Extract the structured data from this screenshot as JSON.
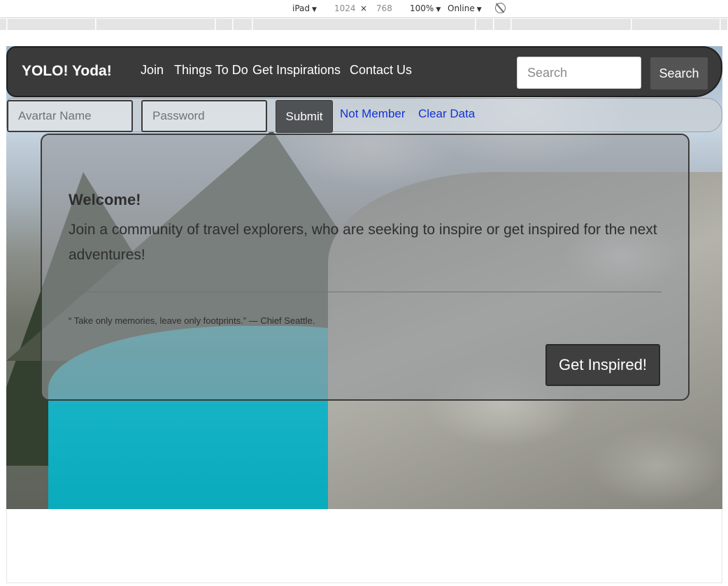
{
  "devtools": {
    "device": "iPad",
    "width": "1024",
    "times": "×",
    "height": "768",
    "zoom": "100%",
    "network": "Online",
    "caret": "▼"
  },
  "navbar": {
    "brand": "YOLO! Yoda!",
    "links": [
      "Join",
      "Things To Do",
      "Get Inspirations",
      "Contact Us"
    ],
    "search_placeholder": "Search",
    "search_button": "Search"
  },
  "login": {
    "name_placeholder": "Avartar Name",
    "password_placeholder": "Password",
    "submit": "Submit",
    "not_member": "Not Member",
    "clear_data": "Clear Data"
  },
  "jumbotron": {
    "heading": "Welcome!",
    "lead": "Join a community of travel explorers, who are seeking to inspire or get inspired for the next adventures!",
    "quote": "“ Take only memories, leave only footprints.” — Chief Seattle.",
    "button": "Get Inspired!"
  },
  "colors": {
    "navbar_bg": "#3a3a3a",
    "link_blue": "#1132d6",
    "lake": "#07a9bb"
  }
}
